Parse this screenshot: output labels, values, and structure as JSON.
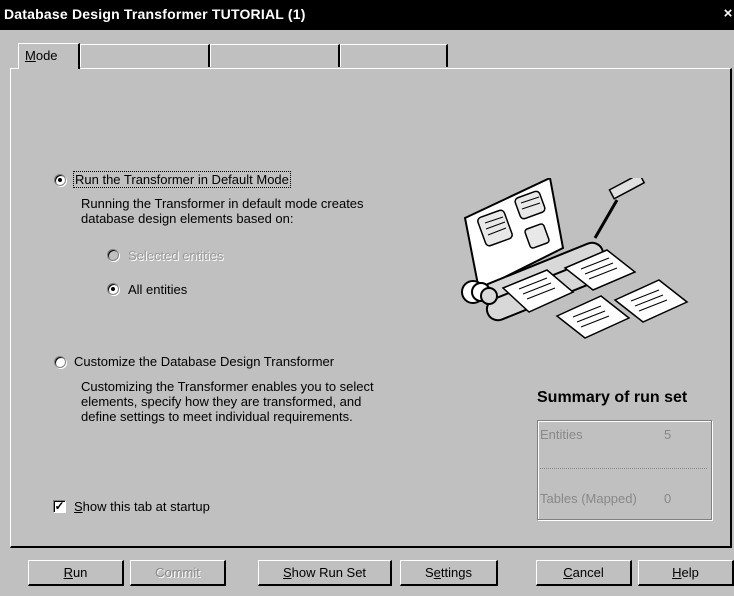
{
  "window": {
    "title": "Database Design Transformer TUTORIAL (1)",
    "close_glyph": "×"
  },
  "tabs": [
    {
      "label": "Mode",
      "mnemonic": "M",
      "rest": "ode",
      "active": true
    },
    {
      "label": "",
      "active": false
    },
    {
      "label": "",
      "active": false
    },
    {
      "label": "",
      "active": false
    }
  ],
  "mode": {
    "default_option": {
      "label": "Run the Transformer in Default Mode",
      "selected": true,
      "description_line1": "Running the Transformer in default mode creates",
      "description_line2": "database design elements based on:"
    },
    "sub_options": [
      {
        "label": "Selected entities",
        "selected": false,
        "enabled": false
      },
      {
        "label": "All entities",
        "selected": true,
        "enabled": true
      }
    ],
    "customize_option": {
      "label": "Customize the Database Design Transformer",
      "selected": false,
      "description_line1": "Customizing the Transformer enables you to select",
      "description_line2": "elements, specify how they are transformed, and",
      "description_line3": "define settings to meet individual requirements."
    },
    "show_tab": {
      "label": "Show this tab at startup",
      "mnemonic": "S",
      "rest": "how this tab at startup",
      "checked": true
    }
  },
  "summary": {
    "title": "Summary of run set",
    "rows": [
      {
        "label": "Entities",
        "value": "5"
      },
      {
        "label": "Tables (Mapped)",
        "value": "0"
      }
    ]
  },
  "buttons": {
    "run": {
      "mn": "R",
      "rest": "un"
    },
    "commit": {
      "label": "Commit"
    },
    "show_run_set": {
      "mn": "S",
      "rest": "how Run Set"
    },
    "settings": {
      "pre": "S",
      "mn": "e",
      "rest": "ttings"
    },
    "cancel": {
      "mn": "C",
      "rest": "ancel"
    },
    "help": {
      "mn": "H",
      "rest": "elp"
    }
  },
  "illustration": {
    "icon": "transformer-illustration-icon"
  }
}
